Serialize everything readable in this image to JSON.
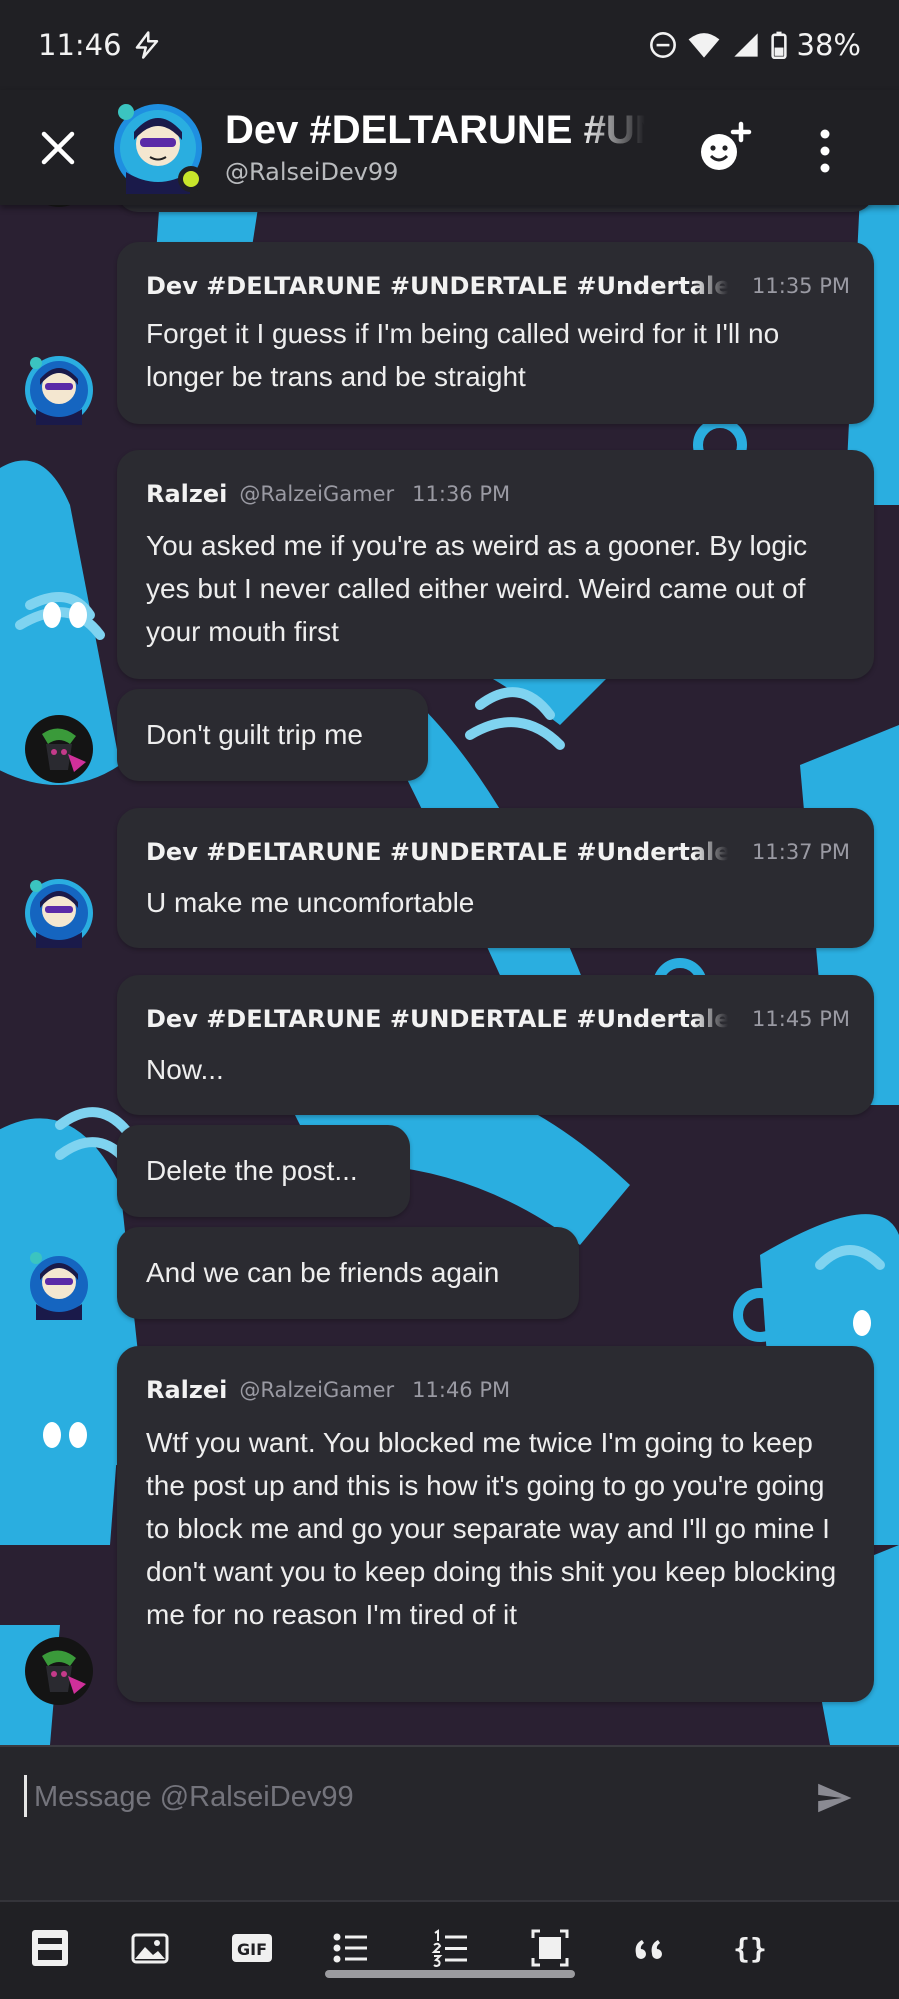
{
  "status_bar": {
    "time": "11:46",
    "battery": "38%"
  },
  "header": {
    "title": "Dev #DELTARUNE #UNDERTALE",
    "subtitle": "@RalseiDev99"
  },
  "messages": [
    {
      "author": "Dev #DELTARUNE #UNDERTALE #Undertale",
      "time": "11:35 PM",
      "text": "Forget it I guess if I'm being called weird for it I'll no longer be trans and be straight"
    },
    {
      "author": "Ralzei",
      "handle": "@RalzeiGamer",
      "time": "11:36 PM",
      "text": "You asked me if you're as weird as a gooner.  By logic yes but I never called either weird. Weird came out of your mouth first"
    },
    {
      "text": "Don't guilt trip me"
    },
    {
      "author": "Dev #DELTARUNE #UNDERTALE #Undertale",
      "time": "11:37 PM",
      "text": "U make me uncomfortable"
    },
    {
      "author": "Dev #DELTARUNE #UNDERTALE #Undertale",
      "time": "11:45 PM",
      "text": "Now..."
    },
    {
      "text": "Delete the post..."
    },
    {
      "text": "And we can be friends again"
    },
    {
      "author": "Ralzei",
      "handle": "@RalzeiGamer",
      "time": "11:46 PM",
      "text": "Wtf you want. You blocked me twice I'm going to keep the post up and this is how it's going to go you're going to block me and go your separate way and I'll go mine I don't want you to keep doing this shit you keep blocking me for no reason I'm tired of it"
    }
  ],
  "composer": {
    "placeholder": "Message @RalseiDev99"
  },
  "toolbar": {
    "gif_label": "GIF",
    "code_label": "{}"
  },
  "colors": {
    "background": "#2a2032",
    "bubble": "#2b2b31",
    "wallpaper_shape": "#29b6e3",
    "presence_online": "#c8e62b"
  }
}
